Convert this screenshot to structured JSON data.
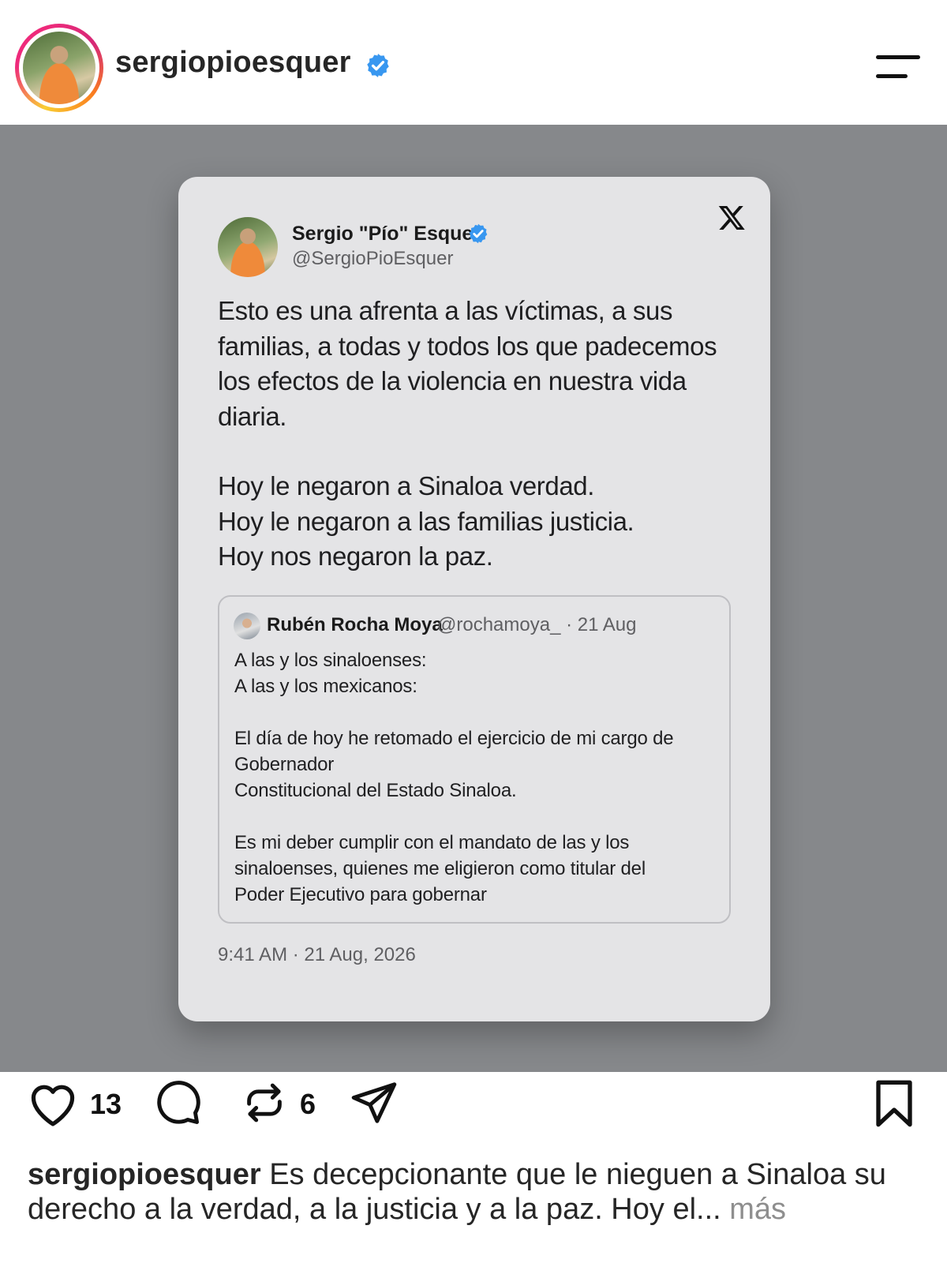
{
  "header": {
    "username": "sergiopioesquer"
  },
  "tweet": {
    "author_name": "Sergio \"Pío\" Esquer",
    "author_handle": "@SergioPioEsquer",
    "paragraph1": "Esto es una afrenta a las víctimas, a sus familias, a todas y todos los que padecemos los efectos de la violencia en nuestra vida diaria.",
    "line2": "Hoy le negaron a Sinaloa verdad.",
    "line3": "Hoy le negaron a las familias justicia.",
    "line4": "Hoy nos negaron la paz.",
    "timestamp": "9:41 AM · 21 Aug, 2026",
    "quote": {
      "author_name": "Rubén Rocha Moya",
      "meta": "@rochamoya_ · 21 Aug",
      "line1": "A las y los sinaloenses:",
      "line2": "A las y los mexicanos:",
      "para2_line1": "El día de hoy he retomado el ejercicio de mi cargo de",
      "para2_line2": "Gobernador",
      "para2_line3": "Constitucional del Estado Sinaloa.",
      "para3_line1": "Es mi deber cumplir con el mandato de las y los",
      "para3_line2": "sinaloenses, quienes me eligieron como titular del",
      "para3_line3": "Poder Ejecutivo para gobernar"
    }
  },
  "actions": {
    "likes": "13",
    "reposts": "6"
  },
  "caption": {
    "username": "sergiopioesquer",
    "text": "Es decepcionante que le nieguen a Sinaloa su derecho a la verdad, a la justicia y a la paz. Hoy el...",
    "more": "más"
  },
  "icons": {
    "verified": "verified-badge-icon",
    "menu": "hamburger-menu-icon",
    "x": "x-logo-icon",
    "like": "heart-icon",
    "comment": "comment-icon",
    "repost": "repost-icon",
    "share": "send-icon",
    "save": "bookmark-icon"
  },
  "colors": {
    "verified_blue": "#3897f0",
    "post_background": "#86888b",
    "card_background": "#e4e4e6"
  }
}
